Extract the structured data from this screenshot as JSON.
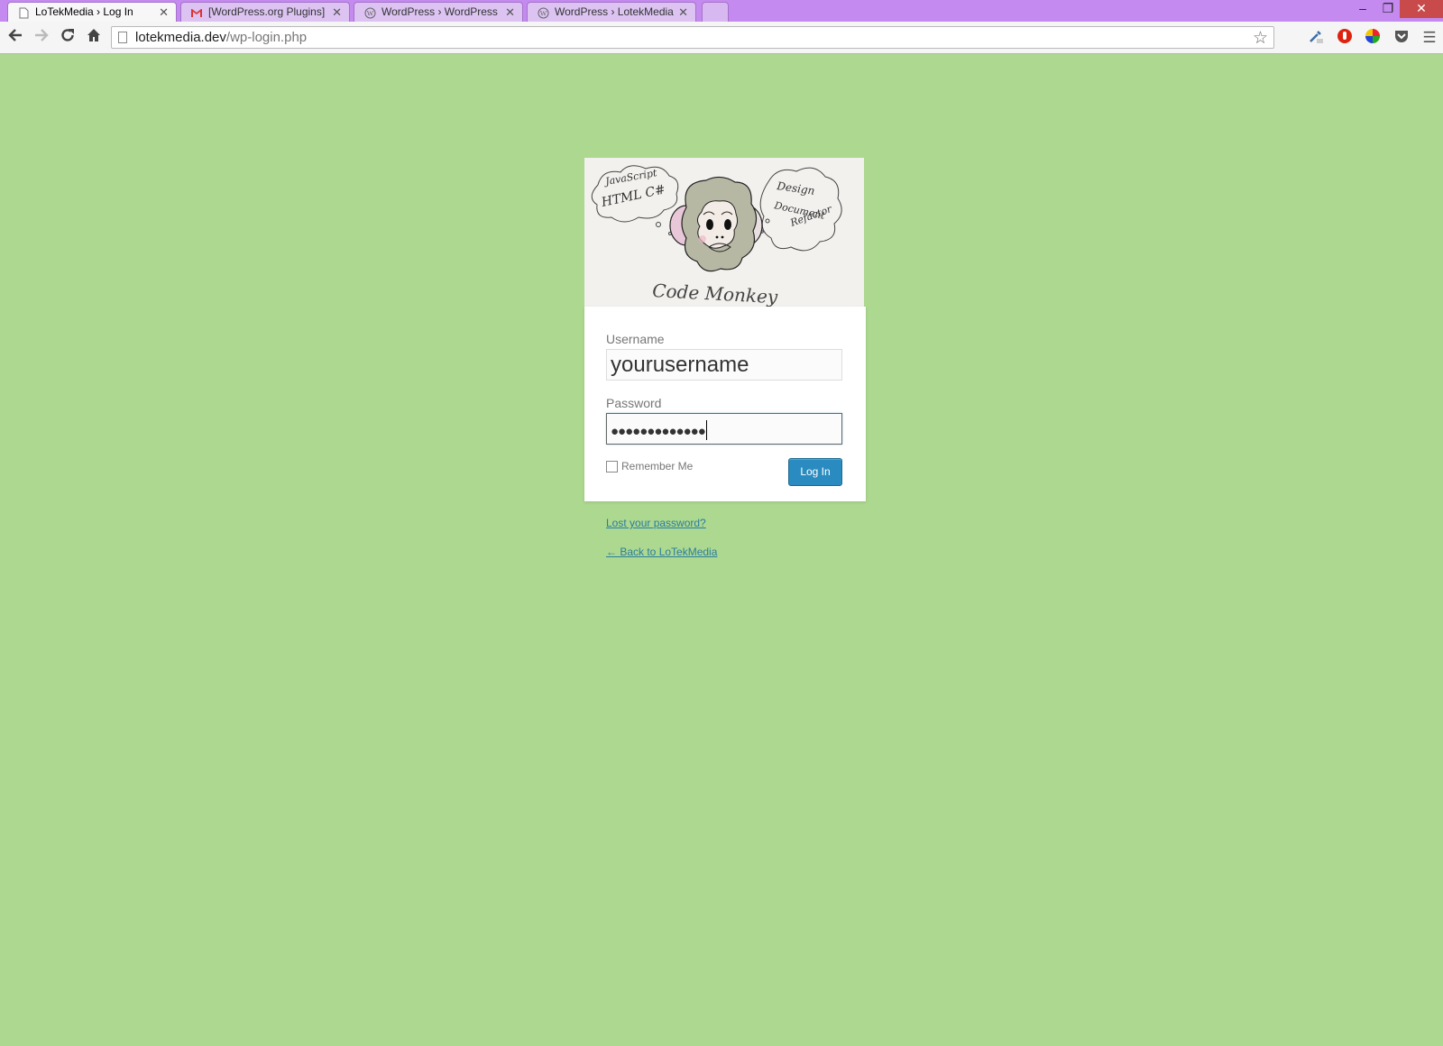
{
  "browser": {
    "tabs": [
      {
        "label": "LoTekMedia › Log In",
        "icon": "page-icon",
        "active": true
      },
      {
        "label": "[WordPress.org Plugins] R",
        "icon": "gmail-icon",
        "active": false
      },
      {
        "label": "WordPress › WordPress Pl",
        "icon": "wordpress-icon",
        "active": false
      },
      {
        "label": "WordPress › LotekMedia C",
        "icon": "wordpress-icon",
        "active": false
      }
    ],
    "url_host": "lotekmedia.dev",
    "url_path": "/wp-login.php"
  },
  "logo": {
    "caption": "Code Monkey",
    "left_bubble_lines": [
      "JavaScript",
      "HTML C#"
    ],
    "right_bubble_lines": [
      "Design",
      "Document",
      "Refactor"
    ]
  },
  "login": {
    "username_label": "Username",
    "username_value": "yourusername",
    "password_label": "Password",
    "password_dots": "●●●●●●●●●●●●●",
    "remember_label": "Remember Me",
    "submit_label": "Log In"
  },
  "links": {
    "lost_password": "Lost your password?",
    "back_to_site": "← Back to LoTekMedia"
  },
  "colors": {
    "background": "#acd88f",
    "button": "#2a8bc0",
    "link": "#2c7d9e",
    "titlebar": "#c58af0"
  }
}
